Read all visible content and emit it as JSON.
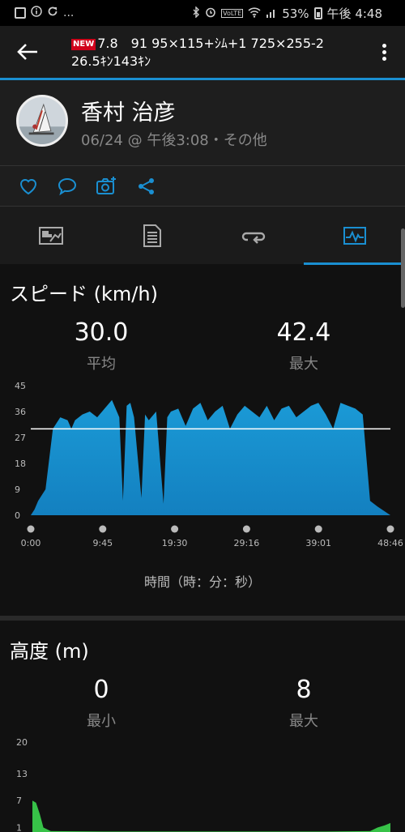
{
  "status_bar": {
    "dots": "...",
    "battery": "53%",
    "time": "午後 4:48",
    "volte": "VoLTE"
  },
  "app_bar": {
    "new_badge": "NEW",
    "title_line1": "7.8　91 95×115+ｼﾑ+1 725×255-2",
    "title_line2": "26.5ｷﾝ143ｷﾝ"
  },
  "profile": {
    "name": "香村 治彦",
    "meta": "06/24 @ 午後3:08・その他"
  },
  "speed": {
    "title": "スピード (km/h)",
    "avg_value": "30.0",
    "avg_label": "平均",
    "max_value": "42.4",
    "max_label": "最大",
    "xlabel": "時間（時：分：秒）"
  },
  "altitude": {
    "title": "高度 (m)",
    "min_value": "0",
    "min_label": "最小",
    "max_value": "8",
    "max_label": "最大"
  },
  "colors": {
    "accent": "#1a8fd1",
    "speed_fill": "#1b9ad6",
    "altitude_fill": "#37c248"
  },
  "chart_data": [
    {
      "type": "area",
      "title": "スピード (km/h)",
      "xlabel": "時間（時：分：秒）",
      "ylabel": "",
      "y_ticks": [
        0,
        9,
        18,
        27,
        36,
        45
      ],
      "ylim": [
        0,
        45
      ],
      "x_ticks": [
        "0:00",
        "9:45",
        "19:30",
        "29:16",
        "39:01",
        "48:46"
      ],
      "average_line": 30.0,
      "x_minutes": [
        0,
        0.5,
        1.0,
        2.0,
        3.0,
        4.0,
        5.0,
        5.5,
        6.0,
        7.0,
        8.0,
        9.0,
        10.0,
        11.0,
        12.0,
        12.5,
        13.0,
        13.5,
        14.0,
        15.0,
        15.5,
        16.0,
        17.0,
        18.0,
        18.5,
        19.0,
        20.0,
        21.0,
        22.0,
        23.0,
        24.0,
        25.0,
        26.0,
        27.0,
        28.0,
        29.0,
        30.0,
        31.0,
        32.0,
        33.0,
        34.0,
        35.0,
        36.0,
        37.0,
        38.0,
        39.0,
        40.0,
        41.0,
        42.0,
        43.0,
        44.0,
        45.0,
        46.0,
        47.0,
        48.76
      ],
      "speed_values": [
        0,
        2,
        5,
        9,
        30,
        34,
        33,
        30,
        33,
        35,
        36,
        34,
        37,
        40,
        34,
        5,
        38,
        39,
        34,
        6,
        35,
        33,
        36,
        4,
        34,
        36,
        37,
        31,
        37,
        39,
        33,
        36,
        38,
        30,
        35,
        38,
        36,
        34,
        38,
        33,
        37,
        38,
        34,
        36,
        38,
        39,
        35,
        30,
        39,
        38,
        37,
        35,
        5,
        3,
        0
      ]
    },
    {
      "type": "area",
      "title": "高度 (m)",
      "y_ticks": [
        1,
        7,
        13,
        20
      ],
      "ylim": [
        0,
        20
      ],
      "x_minutes": [
        0,
        0.5,
        1.0,
        1.5,
        2.5,
        10,
        20,
        30,
        40,
        46,
        47,
        48.0,
        48.76
      ],
      "altitude_values": [
        7,
        6.5,
        4,
        1,
        0.2,
        0.1,
        0.1,
        0.1,
        0.1,
        0.2,
        1,
        1.5,
        2
      ]
    }
  ]
}
